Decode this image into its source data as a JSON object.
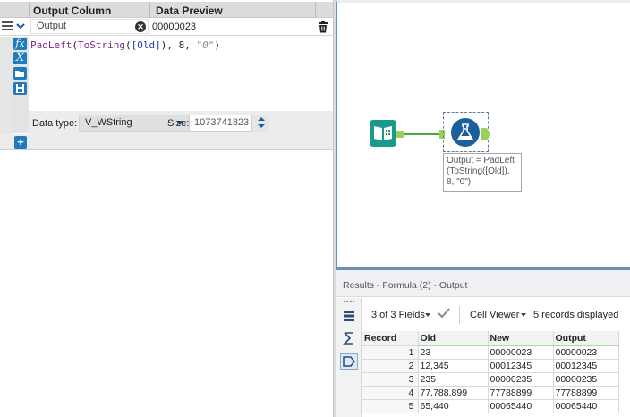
{
  "formula_panel": {
    "column_header": "Output Column",
    "preview_header": "Data Preview",
    "output_field": "Output",
    "preview_value": "00000023",
    "expression": {
      "fn1": "PadLeft",
      "p1": "(",
      "fn2": "ToString",
      "p2": "(",
      "field": "[Old]",
      "p3": "), 8, ",
      "str": "\"0\"",
      "p4": ")"
    },
    "data_type_label": "Data type:",
    "data_type_value": "V_WString",
    "size_label": "Size:",
    "size_value": "1073741823",
    "add_label": "+"
  },
  "canvas": {
    "annotation": "Output = PadLeft (ToString([Old]), 8, \"0\")"
  },
  "results": {
    "title": "Results - Formula (2) - Output",
    "fields_label": "3 of 3 Fields",
    "viewer_label": "Cell Viewer",
    "records_label": "5 records displayed",
    "columns": [
      "Record",
      "Old",
      "New",
      "Output"
    ],
    "rows": [
      [
        "1",
        "23",
        "00000023",
        "00000023"
      ],
      [
        "2",
        "12,345",
        "00012345",
        "00012345"
      ],
      [
        "3",
        "235",
        "00000235",
        "00000235"
      ],
      [
        "4",
        "77,788,899",
        "77788899",
        "77788899"
      ],
      [
        "5",
        "65,440",
        "00065440",
        "00065440"
      ]
    ]
  },
  "icons": [
    "menu-icon",
    "chevron-down-icon",
    "clear-icon",
    "trash-icon",
    "fx-icon",
    "variable-x-icon",
    "open-icon",
    "save-icon",
    "book-icon",
    "flask-icon",
    "table-icon",
    "sum-icon",
    "tag-icon",
    "check-icon"
  ],
  "colors": {
    "tool_blue": "#1f7bbd",
    "input_teal": "#1a9a8c",
    "formula_blue": "#1b5f9b",
    "connector_green": "#9ad058"
  }
}
